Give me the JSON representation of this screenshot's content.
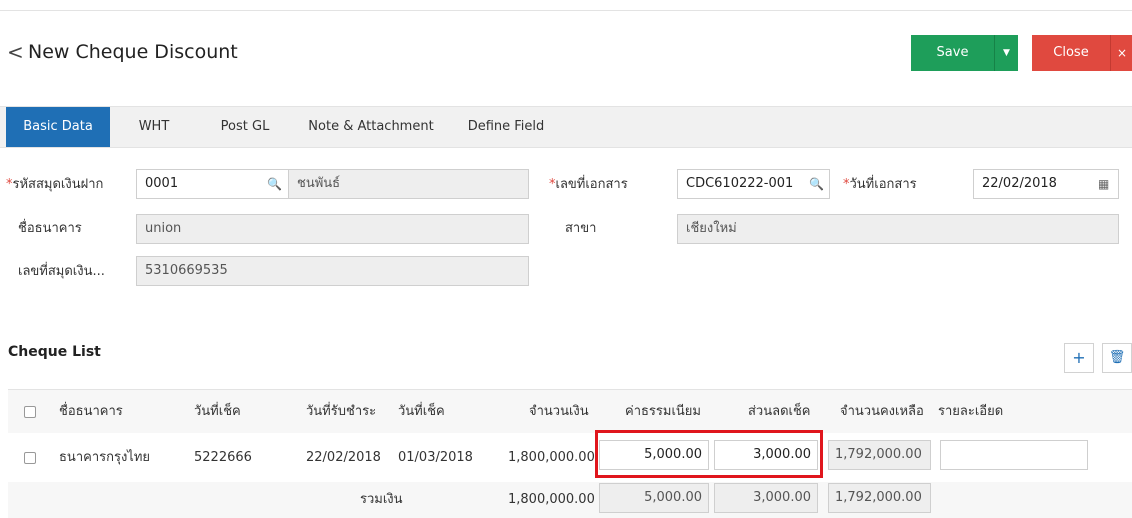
{
  "header": {
    "back_glyph": "<",
    "title": "New Cheque Discount",
    "save_label": "Save",
    "save_dropdown_glyph": "▼",
    "close_label": "Close",
    "close_x_glyph": "×"
  },
  "tabs": [
    "Basic Data",
    "WHT",
    "Post GL",
    "Note & Attachment",
    "Define Field"
  ],
  "form": {
    "required_mark": "*",
    "book_code_label": "รหัสสมุดเงินฝาก",
    "book_code_value": "0001",
    "book_name_value": "ชนพันธ์",
    "doc_no_label": "เลขที่เอกสาร",
    "doc_no_value": "CDC610222-001",
    "doc_date_label": "วันที่เอกสาร",
    "doc_date_value": "22/02/2018",
    "bank_label": "ชื่อธนาคาร",
    "bank_value": "union",
    "branch_label": "สาขา",
    "branch_value": "เชียงใหม่",
    "account_no_label": "เลขที่สมุดเงิน...",
    "account_no_value": "5310669535",
    "search_glyph": "🔍",
    "calendar_glyph": "▦"
  },
  "cheque_list": {
    "title": "Cheque List",
    "add_glyph": "+",
    "delete_glyph": "🗑",
    "columns": [
      "ชื่อธนาคาร",
      "วันที่เช็ค",
      "วันที่รับชำระ",
      "วันที่เช็ค",
      "จำนวนเงิน",
      "ค่าธรรมเนียม",
      "ส่วนลดเช็ค",
      "จำนวนคงเหลือ",
      "รายละเอียด"
    ],
    "rows": [
      {
        "bank": "ธนาคารกรุงไทย",
        "cheque_no": "5222666",
        "receive_date": "22/02/2018",
        "cheque_date": "01/03/2018",
        "amount": "1,800,000.00",
        "fee": "5,000.00",
        "discount": "3,000.00",
        "remaining": "1,792,000.00",
        "detail": ""
      }
    ],
    "total": {
      "label": "รวมเงิน",
      "amount": "1,800,000.00",
      "fee": "5,000.00",
      "discount": "3,000.00",
      "remaining": "1,792,000.00"
    }
  },
  "colors": {
    "primary": "#1f6fb5",
    "save": "#1e9e5a",
    "close": "#e0493f",
    "highlight": "#e0161d"
  }
}
